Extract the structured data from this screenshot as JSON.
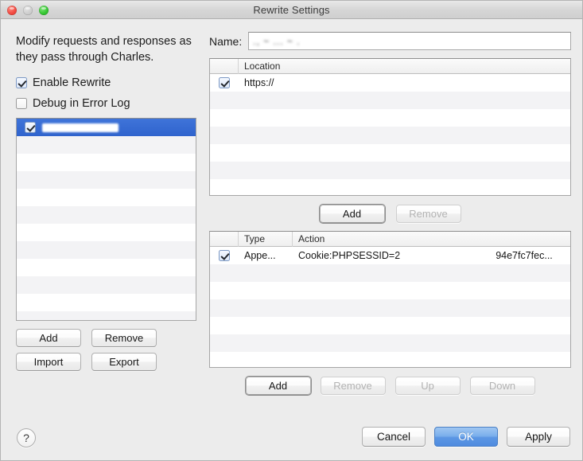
{
  "window": {
    "title": "Rewrite Settings",
    "traffic_lights": [
      "close",
      "minimize",
      "maximize"
    ]
  },
  "left": {
    "description": "Modify requests and responses as they pass through Charles.",
    "checkboxes": [
      {
        "label": "Enable Rewrite",
        "checked": true
      },
      {
        "label": "Debug in Error Log",
        "checked": false
      }
    ],
    "rule_list": {
      "rows": [
        {
          "checked": true,
          "label": "",
          "redacted": true,
          "selected": true
        }
      ],
      "empty_row_count": 11
    },
    "buttons": [
      {
        "label": "Add",
        "enabled": true
      },
      {
        "label": "Remove",
        "enabled": true
      },
      {
        "label": "Import",
        "enabled": true
      },
      {
        "label": "Export",
        "enabled": true
      }
    ]
  },
  "right": {
    "name_label": "Name:",
    "name_value": ".,    ~ ... ~   .",
    "location_table": {
      "columns": [
        "",
        "Location"
      ],
      "rows": [
        {
          "checked": true,
          "location": "https://",
          "redacted_tail": true
        }
      ],
      "empty_row_count": 6
    },
    "location_buttons": [
      {
        "label": "Add",
        "enabled": true
      },
      {
        "label": "Remove",
        "enabled": false
      }
    ],
    "action_table": {
      "columns": [
        "",
        "Type",
        "Action"
      ],
      "rows": [
        {
          "checked": true,
          "type": "Appe...",
          "action_prefix": "Cookie:PHPSESSID=2",
          "action_suffix": "94e7fc7fec...",
          "redacted_middle": true
        }
      ],
      "empty_row_count": 6
    },
    "action_buttons": [
      {
        "label": "Add",
        "enabled": true
      },
      {
        "label": "Remove",
        "enabled": false
      },
      {
        "label": "Up",
        "enabled": false
      },
      {
        "label": "Down",
        "enabled": false
      }
    ]
  },
  "footer": {
    "help_glyph": "?",
    "buttons": [
      {
        "label": "Cancel",
        "default": false
      },
      {
        "label": "OK",
        "default": true
      },
      {
        "label": "Apply",
        "default": false
      }
    ]
  },
  "colors": {
    "accent_selection": "#3366cc",
    "default_button": "#5b96e4",
    "dialog_bg": "#ececec"
  }
}
